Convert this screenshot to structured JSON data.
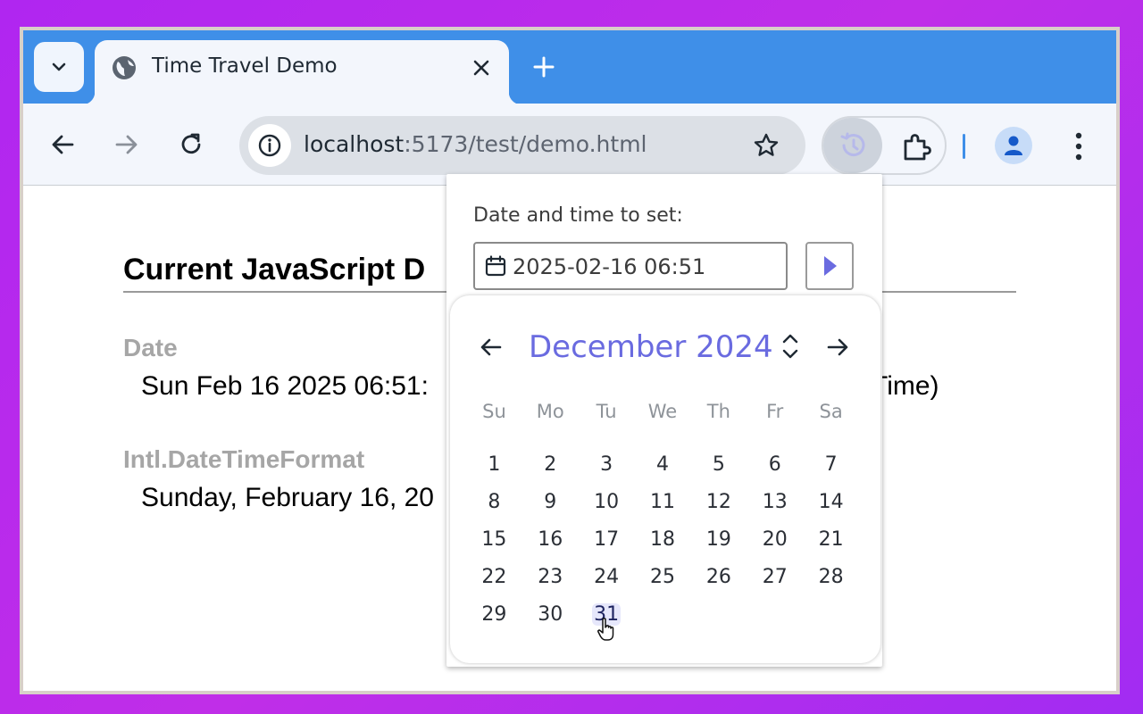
{
  "browser": {
    "tab_title": "Time Travel Demo",
    "url_host": "localhost",
    "url_rest": ":5173/test/demo.html"
  },
  "page": {
    "heading": "Current JavaScript D",
    "date_label": "Date",
    "date_value": "Sun Feb 16 2025 06:51:",
    "date_value_tail": "Time)",
    "intl_label": "Intl.DateTimeFormat",
    "intl_value": "Sunday, February 16, 20"
  },
  "popup": {
    "label": "Date and time to set:",
    "input_value": "2025-02-16 06:51",
    "calendar": {
      "title": "December 2024",
      "weekdays": [
        "Su",
        "Mo",
        "Tu",
        "We",
        "Th",
        "Fr",
        "Sa"
      ],
      "weeks": [
        [
          "1",
          "2",
          "3",
          "4",
          "5",
          "6",
          "7"
        ],
        [
          "8",
          "9",
          "10",
          "11",
          "12",
          "13",
          "14"
        ],
        [
          "15",
          "16",
          "17",
          "18",
          "19",
          "20",
          "21"
        ],
        [
          "22",
          "23",
          "24",
          "25",
          "26",
          "27",
          "28"
        ],
        [
          "29",
          "30",
          "31",
          "",
          "",
          "",
          ""
        ]
      ],
      "hovered_day": "31"
    }
  },
  "colors": {
    "accent": "#6a6be0",
    "tabbar": "#3f8fe8",
    "frame_bg": "#b026f0"
  },
  "icons": {
    "tab_search": "chevron-down-icon",
    "favicon": "globe-icon",
    "close": "close-icon",
    "new_tab": "plus-icon",
    "back": "arrow-left-icon",
    "forward": "arrow-right-icon",
    "reload": "reload-icon",
    "site_info": "info-icon",
    "bookmark": "star-icon",
    "extension": "clock-history-icon",
    "extensions_menu": "puzzle-icon",
    "profile": "person-icon",
    "menu": "kebab-menu-icon"
  }
}
